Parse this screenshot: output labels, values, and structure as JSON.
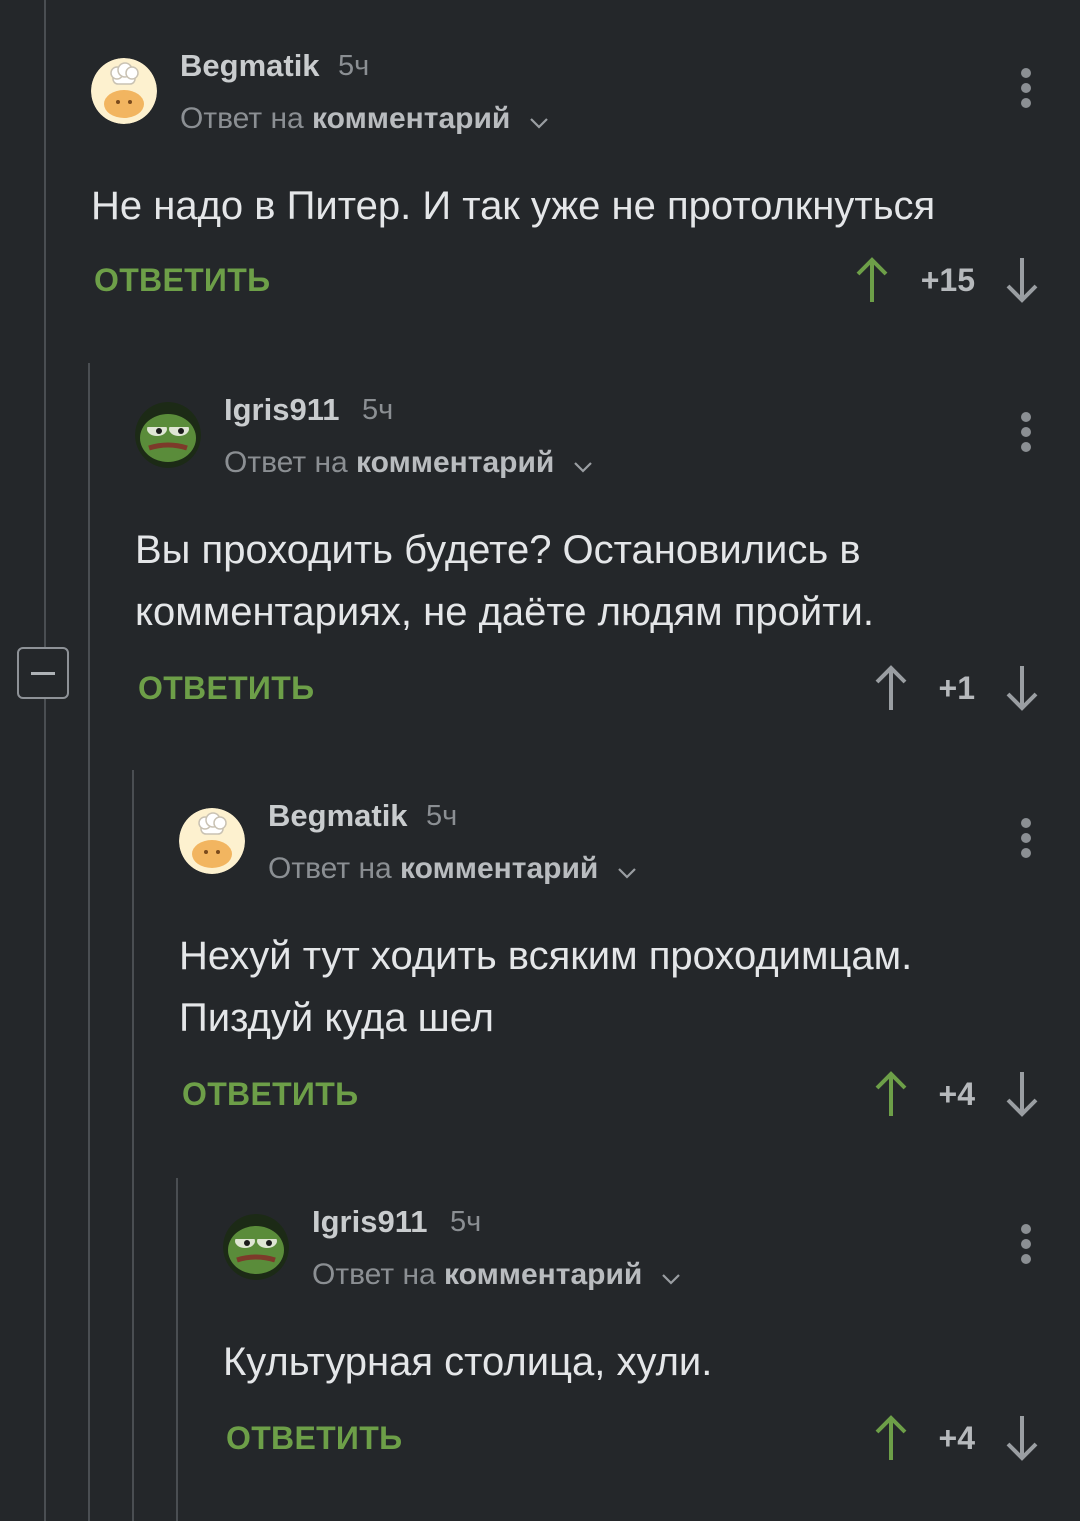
{
  "colors": {
    "background": "#24272a",
    "reply_green": "#6d9f48",
    "upvote_active": "#6d9f48",
    "upvote_neutral": "#9a9ea2",
    "muted_text": "#8b8f93"
  },
  "thread": {
    "collapse_icon": "minus-square-icon",
    "comments": [
      {
        "author": "Begmatik",
        "time": "5ч",
        "reply_prefix": "Ответ на",
        "reply_target": "комментарий",
        "text": "Не надо в Питер. И так уже не протолкнуться",
        "reply_label": "ОТВЕТИТЬ",
        "score": "+15",
        "upvoted": true,
        "avatar": "chef-cat-avatar"
      },
      {
        "author": "Igris911",
        "time": "5ч",
        "reply_prefix": "Ответ на",
        "reply_target": "комментарий",
        "text": "Вы проходить будете? Остановились в комментариях, не даёте людям пройти.",
        "reply_label": "ОТВЕТИТЬ",
        "score": "+1",
        "upvoted": false,
        "avatar": "pepe-frog-avatar"
      },
      {
        "author": "Begmatik",
        "time": "5ч",
        "reply_prefix": "Ответ на",
        "reply_target": "комментарий",
        "text": "Нехуй тут ходить всяким проходимцам. Пиздуй куда шел",
        "reply_label": "ОТВЕТИТЬ",
        "score": "+4",
        "upvoted": true,
        "avatar": "chef-cat-avatar"
      },
      {
        "author": "Igris911",
        "time": "5ч",
        "reply_prefix": "Ответ на",
        "reply_target": "комментарий",
        "text": "Культурная столица, хули.",
        "reply_label": "ОТВЕТИТЬ",
        "score": "+4",
        "upvoted": true,
        "avatar": "pepe-frog-avatar"
      }
    ]
  }
}
